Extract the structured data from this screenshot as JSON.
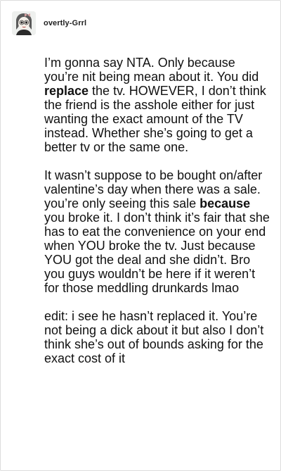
{
  "post": {
    "username": "overtly-Grrl",
    "avatar_icon": "avatar-cartoon-icon"
  },
  "body": {
    "p1": {
      "a": "I’m gonna say NTA. Only because you’re nit being mean about it. You did ",
      "bold": "replace",
      "b": " the tv. HOWEVER, I don’t think the friend is the asshole either for just wanting the exact amount of the TV instead. Whether she’s going to get a better tv or the same one."
    },
    "p2": {
      "a": "It wasn’t suppose to be bought on/after valentine’s day when there was a sale. you’re only seeing this sale ",
      "bold": "because",
      "b": " you broke it. I don’t think it’s fair that she has to eat the convenience on your end when YOU broke the tv. Just because YOU got the deal and she didn’t. Bro you guys wouldn’t be here if it weren’t for those meddling drunkards lmao"
    },
    "p3": "edit: i see he hasn’t replaced it. You’re not being a dick about it but also I don’t think she’s out of bounds asking for the exact cost of it"
  }
}
